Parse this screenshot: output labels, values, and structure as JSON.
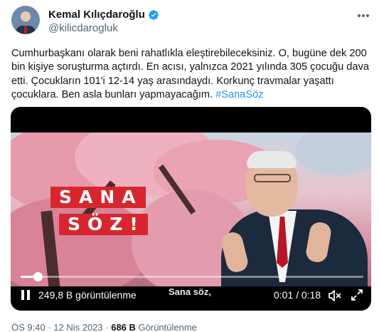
{
  "author": {
    "name": "Kemal Kılıçdaroğlu",
    "handle": "@kilicdarogluk"
  },
  "icons": {
    "verified": "verified-badge-icon",
    "more": "more-options-icon"
  },
  "tweet": {
    "text": "Cumhurbaşkanı olarak beni rahatlıkla eleştirebileceksiniz. O, bugüne dek 200 bin kişiye soruşturma açtırdı. En acısı, yalnızca 2021 yılında 305 çocuğu dava etti. Çocukların 101'i 12-14 yaş arasındaydı. Korkunç travmalar yaşattı çocuklara. Ben asla bunları yapmayacağım. ",
    "hashtag": "#SanaSöz"
  },
  "video": {
    "overlay_line1": "SANA",
    "overlay_line2": "SÖZ!",
    "progress": 0.05,
    "views": "249,8 B görüntülenme",
    "caption": "Sana söz,",
    "time": "0:01 / 0:18"
  },
  "meta": {
    "time": "ÖS 9:40",
    "sep1": " · ",
    "date": "12 Nis 2023",
    "sep2": " · ",
    "view_count": "686 B",
    "view_label": " Görüntülenme"
  },
  "colors": {
    "accent": "#1d9bf0",
    "overlay_red": "#d8262e"
  }
}
